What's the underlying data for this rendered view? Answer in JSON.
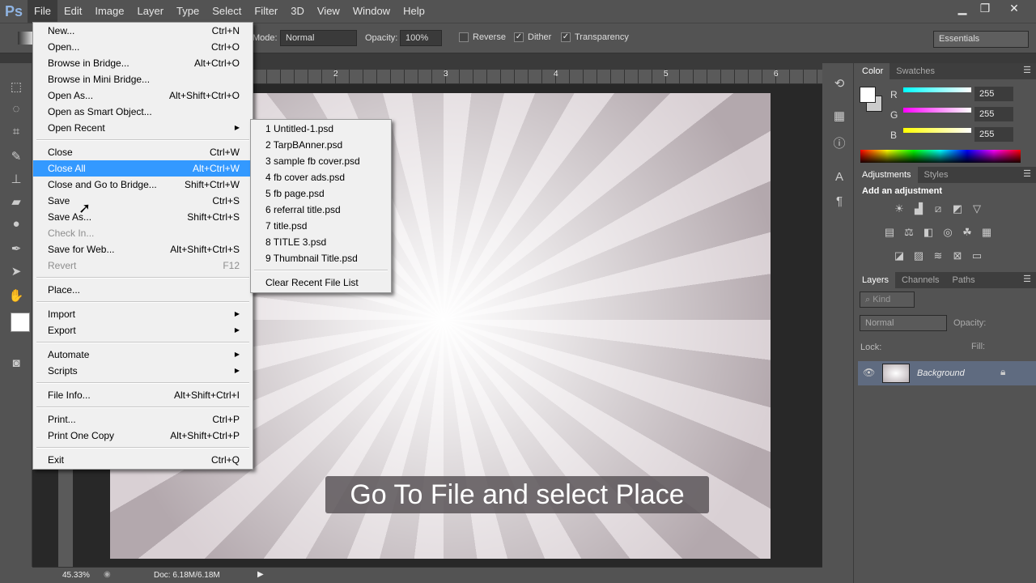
{
  "app": {
    "logo": "Ps"
  },
  "menubar": [
    "File",
    "Edit",
    "Image",
    "Layer",
    "Type",
    "Select",
    "Filter",
    "3D",
    "View",
    "Window",
    "Help"
  ],
  "window_controls": {
    "minimize": "▁",
    "restore": "❐",
    "close": "✕"
  },
  "options": {
    "mode_label": "Mode:",
    "mode_value": "Normal",
    "opacity_label": "Opacity:",
    "opacity_value": "100%",
    "reverse": "Reverse",
    "dither": "Dither",
    "transparency": "Transparency",
    "workspace": "Essentials"
  },
  "ruler": [
    "2",
    "3",
    "4",
    "5",
    "6"
  ],
  "file_menu": [
    {
      "label": "New...",
      "shortcut": "Ctrl+N"
    },
    {
      "label": "Open...",
      "shortcut": "Ctrl+O"
    },
    {
      "label": "Browse in Bridge...",
      "shortcut": "Alt+Ctrl+O"
    },
    {
      "label": "Browse in Mini Bridge...",
      "shortcut": ""
    },
    {
      "label": "Open As...",
      "shortcut": "Alt+Shift+Ctrl+O"
    },
    {
      "label": "Open as Smart Object...",
      "shortcut": ""
    },
    {
      "label": "Open Recent",
      "shortcut": "▶"
    },
    {
      "label": "Close",
      "shortcut": "Ctrl+W"
    },
    {
      "label": "Close All",
      "shortcut": "Alt+Ctrl+W"
    },
    {
      "label": "Close and Go to Bridge...",
      "shortcut": "Shift+Ctrl+W"
    },
    {
      "label": "Save",
      "shortcut": "Ctrl+S"
    },
    {
      "label": "Save As...",
      "shortcut": "Shift+Ctrl+S"
    },
    {
      "label": "Check In...",
      "shortcut": ""
    },
    {
      "label": "Save for Web...",
      "shortcut": "Alt+Shift+Ctrl+S"
    },
    {
      "label": "Revert",
      "shortcut": "F12"
    },
    {
      "label": "Place...",
      "shortcut": ""
    },
    {
      "label": "Import",
      "shortcut": "▶"
    },
    {
      "label": "Export",
      "shortcut": "▶"
    },
    {
      "label": "Automate",
      "shortcut": "▶"
    },
    {
      "label": "Scripts",
      "shortcut": "▶"
    },
    {
      "label": "File Info...",
      "shortcut": "Alt+Shift+Ctrl+I"
    },
    {
      "label": "Print...",
      "shortcut": "Ctrl+P"
    },
    {
      "label": "Print One Copy",
      "shortcut": "Alt+Shift+Ctrl+P"
    },
    {
      "label": "Exit",
      "shortcut": "Ctrl+Q"
    }
  ],
  "recent_files": [
    "1  Untitled-1.psd",
    "2  TarpBAnner.psd",
    "3  sample fb cover.psd",
    "4  fb cover ads.psd",
    "5  fb page.psd",
    "6  referral title.psd",
    "7  title.psd",
    "8  TITLE 3.psd",
    "9  Thumbnail Title.psd"
  ],
  "recent_clear": "Clear Recent File List",
  "caption": "Go To File and select Place",
  "status": {
    "zoom": "45.33%",
    "doc": "Doc: 6.18M/6.18M"
  },
  "color_panel": {
    "tabs": [
      "Color",
      "Swatches"
    ],
    "r_label": "R",
    "g_label": "G",
    "b_label": "B",
    "r": "255",
    "g": "255",
    "b": "255"
  },
  "adjustments": {
    "tabs": [
      "Adjustments",
      "Styles"
    ],
    "title": "Add an adjustment"
  },
  "layers": {
    "tabs": [
      "Layers",
      "Channels",
      "Paths"
    ],
    "filter": "Kind",
    "blend": "Normal",
    "opacity_label": "Opacity:",
    "lock_label": "Lock:",
    "fill_label": "Fill:",
    "layer_name": "Background"
  },
  "colors": {
    "highlight": "#3399ff",
    "ui": "#535353"
  }
}
